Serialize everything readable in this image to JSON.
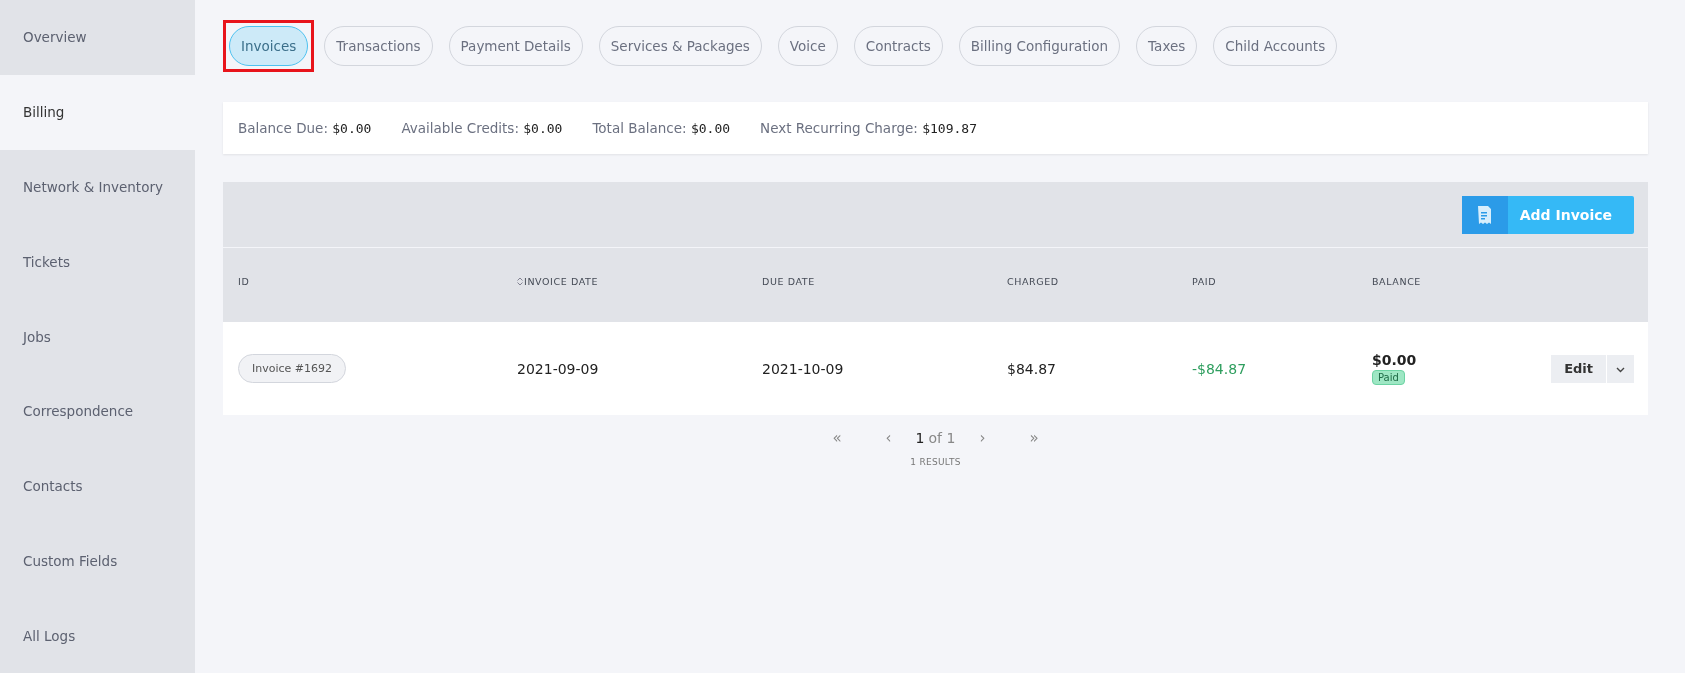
{
  "sidebar": {
    "items": [
      {
        "label": "Overview",
        "selected": false
      },
      {
        "label": "Billing",
        "selected": true
      },
      {
        "label": "Network & Inventory",
        "selected": false
      },
      {
        "label": "Tickets",
        "selected": false
      },
      {
        "label": "Jobs",
        "selected": false
      },
      {
        "label": "Correspondence",
        "selected": false
      },
      {
        "label": "Contacts",
        "selected": false
      },
      {
        "label": "Custom Fields",
        "selected": false
      },
      {
        "label": "All Logs",
        "selected": false
      }
    ]
  },
  "tabs": [
    {
      "label": "Invoices",
      "selected": true,
      "highlighted": true
    },
    {
      "label": "Transactions",
      "selected": false,
      "highlighted": false
    },
    {
      "label": "Payment Details",
      "selected": false,
      "highlighted": false
    },
    {
      "label": "Services & Packages",
      "selected": false,
      "highlighted": false
    },
    {
      "label": "Voice",
      "selected": false,
      "highlighted": false
    },
    {
      "label": "Contracts",
      "selected": false,
      "highlighted": false
    },
    {
      "label": "Billing Configuration",
      "selected": false,
      "highlighted": false
    },
    {
      "label": "Taxes",
      "selected": false,
      "highlighted": false
    },
    {
      "label": "Child Accounts",
      "selected": false,
      "highlighted": false
    }
  ],
  "summary": [
    {
      "label": "Balance Due:",
      "value": "$0.00"
    },
    {
      "label": "Available Credits:",
      "value": "$0.00"
    },
    {
      "label": "Total Balance:",
      "value": "$0.00"
    },
    {
      "label": "Next Recurring Charge:",
      "value": "$109.87"
    }
  ],
  "add_button": {
    "label": "Add Invoice"
  },
  "table": {
    "columns": [
      {
        "label": "ID",
        "sortable": false
      },
      {
        "label": "INVOICE DATE",
        "sortable": true
      },
      {
        "label": "DUE DATE",
        "sortable": false
      },
      {
        "label": "CHARGED",
        "sortable": false
      },
      {
        "label": "PAID",
        "sortable": false
      },
      {
        "label": "BALANCE",
        "sortable": false
      }
    ],
    "rows": [
      {
        "id": "Invoice #1692",
        "invoice_date": "2021-09-09",
        "due_date": "2021-10-09",
        "charged": "$84.87",
        "paid": "-$84.87",
        "balance": "$0.00",
        "status": "Paid",
        "action": "Edit"
      }
    ]
  },
  "pagination": {
    "first": "«",
    "prev": "‹",
    "current": "1",
    "of": "of 1",
    "next": "›",
    "last": "»",
    "results": "1 RESULTS"
  }
}
